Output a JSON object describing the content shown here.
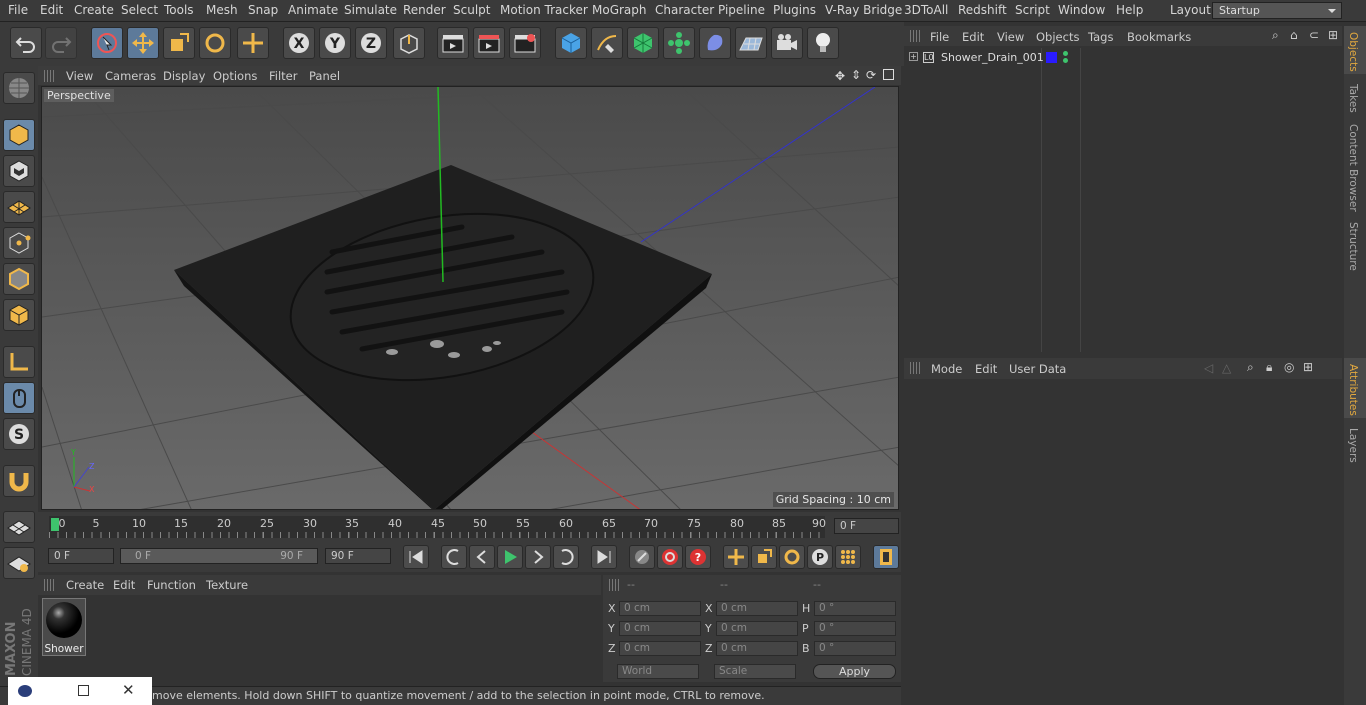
{
  "menubar": {
    "items": [
      "File",
      "Edit",
      "Create",
      "Select",
      "Tools",
      "Mesh",
      "Snap",
      "Animate",
      "Simulate",
      "Render",
      "Sculpt",
      "Motion Tracker",
      "MoGraph",
      "Character",
      "Pipeline",
      "Plugins",
      "V-Ray Bridge",
      "3DToAll",
      "Redshift",
      "Script",
      "Window",
      "Help"
    ],
    "layout_label": "Layout:",
    "layout_value": "Startup"
  },
  "viewport": {
    "menu": [
      "View",
      "Cameras",
      "Display",
      "Options",
      "Filter",
      "Panel"
    ],
    "label": "Perspective",
    "grid_spacing": "Grid Spacing : 10 cm"
  },
  "timeline": {
    "ticks": [
      "0",
      "5",
      "10",
      "15",
      "20",
      "25",
      "30",
      "35",
      "40",
      "45",
      "50",
      "55",
      "60",
      "65",
      "70",
      "75",
      "80",
      "85",
      "90"
    ],
    "current_frame": "0 F",
    "start": "0 F",
    "range_start": "0 F",
    "range_end": "90 F",
    "end": "90 F"
  },
  "material": {
    "menu": [
      "Create",
      "Edit",
      "Function",
      "Texture"
    ],
    "name": "Shower"
  },
  "coordinates": {
    "headers": [
      "--",
      "--",
      "--"
    ],
    "rows": [
      {
        "a": "X",
        "av": "0 cm",
        "b": "X",
        "bv": "0 cm",
        "c": "H",
        "cv": "0 °"
      },
      {
        "a": "Y",
        "av": "0 cm",
        "b": "Y",
        "bv": "0 cm",
        "c": "P",
        "cv": "0 °"
      },
      {
        "a": "Z",
        "av": "0 cm",
        "b": "Z",
        "bv": "0 cm",
        "c": "B",
        "cv": "0 °"
      }
    ],
    "mode": "World",
    "scale": "Scale",
    "apply": "Apply"
  },
  "objects": {
    "menu": [
      "File",
      "Edit",
      "View",
      "Objects",
      "Tags",
      "Bookmarks"
    ],
    "item": "Shower_Drain_001"
  },
  "attributes": {
    "menu": [
      "Mode",
      "Edit",
      "User Data"
    ]
  },
  "side_tabs": [
    "Objects",
    "Takes",
    "Content Browser",
    "Structure"
  ],
  "side_tabs_lower": [
    "Attributes",
    "Layers"
  ],
  "status": "move elements. Hold down SHIFT to quantize movement / add to the selection in point mode, CTRL to remove.",
  "brand": {
    "line1": "MAXON",
    "line2": "CINEMA 4D"
  },
  "colors": {
    "accent": "#5d7a9a",
    "object_swatch": "#2a1bff",
    "tab_selected": "#e3a93f"
  }
}
